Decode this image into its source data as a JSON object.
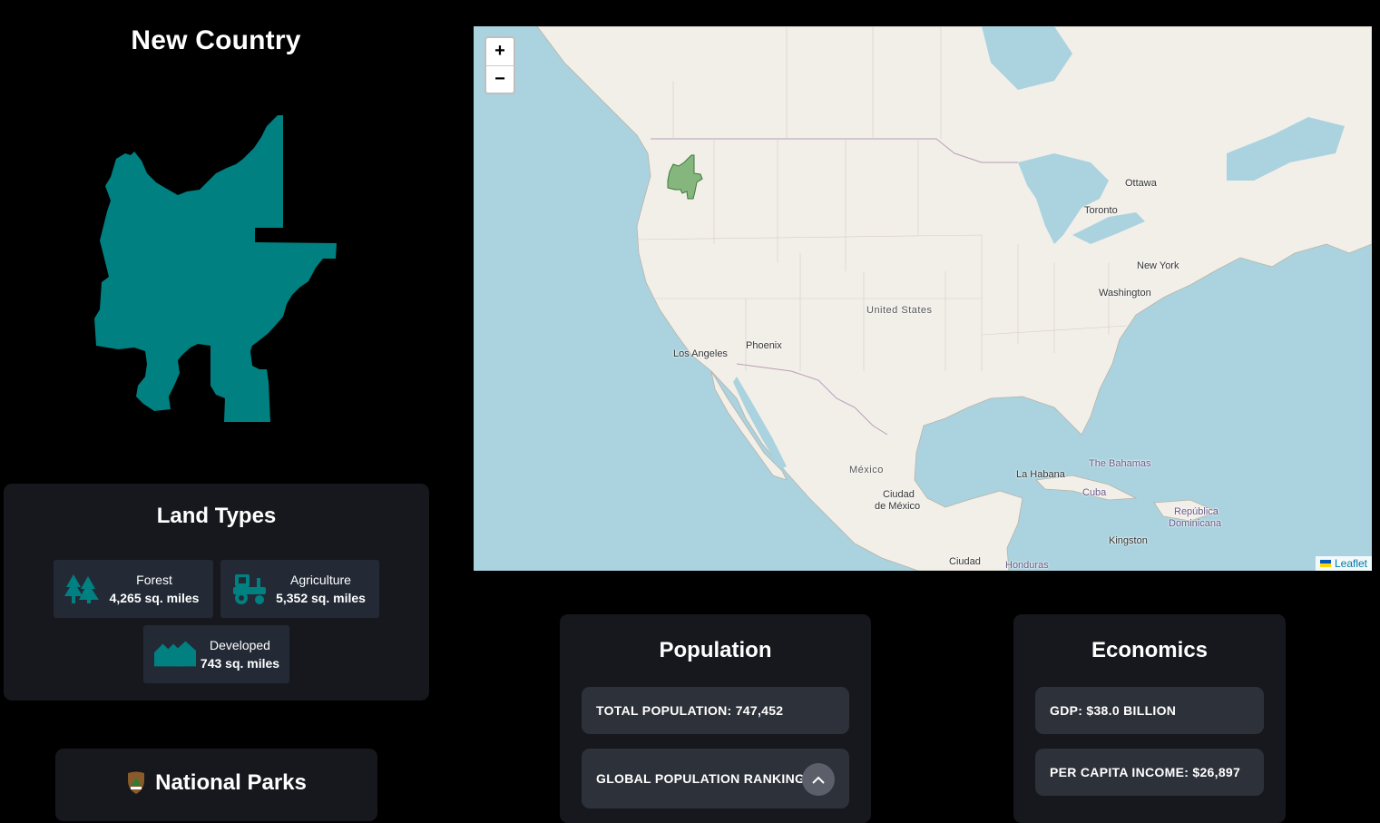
{
  "country": {
    "title": "New Country",
    "shape_color": "#008080"
  },
  "land_types": {
    "title": "Land Types",
    "items": [
      {
        "icon": "forest-icon",
        "name": "Forest",
        "value": "4,265 sq. miles"
      },
      {
        "icon": "tractor-icon",
        "name": "Agriculture",
        "value": "5,352 sq. miles"
      },
      {
        "icon": "houses-icon",
        "name": "Developed",
        "value": "743 sq. miles"
      }
    ]
  },
  "national_parks": {
    "title": "National Parks",
    "icon": "park-badge-icon"
  },
  "map": {
    "zoom_in": "+",
    "zoom_out": "−",
    "attribution": "Leaflet",
    "labels": {
      "ottawa": "Ottawa",
      "toronto": "Toronto",
      "new_york": "New York",
      "washington": "Washington",
      "united_states": "United States",
      "phoenix": "Phoenix",
      "los_angeles": "Los Angeles",
      "mexico": "México",
      "ciudad_de_mexico_1": "Ciudad",
      "ciudad_de_mexico_2": "de México",
      "la_habana": "La Habana",
      "bahamas": "The Bahamas",
      "cuba": "Cuba",
      "republica_1": "República",
      "republica_2": "Dominicana",
      "kingston": "Kingston",
      "ciudad_bottom": "Ciudad",
      "honduras": "Honduras"
    },
    "highlight_color": "#5fa35a"
  },
  "population": {
    "title": "Population",
    "total": "TOTAL POPULATION: 747,452",
    "ranking": "GLOBAL POPULATION RANKING"
  },
  "economics": {
    "title": "Economics",
    "gdp": "GDP: $38.0 BILLION",
    "per_capita": "PER CAPITA INCOME: $26,897"
  },
  "colors": {
    "accent": "#008080",
    "card_bg": "#16181d",
    "stat_bg": "#2d3139"
  }
}
